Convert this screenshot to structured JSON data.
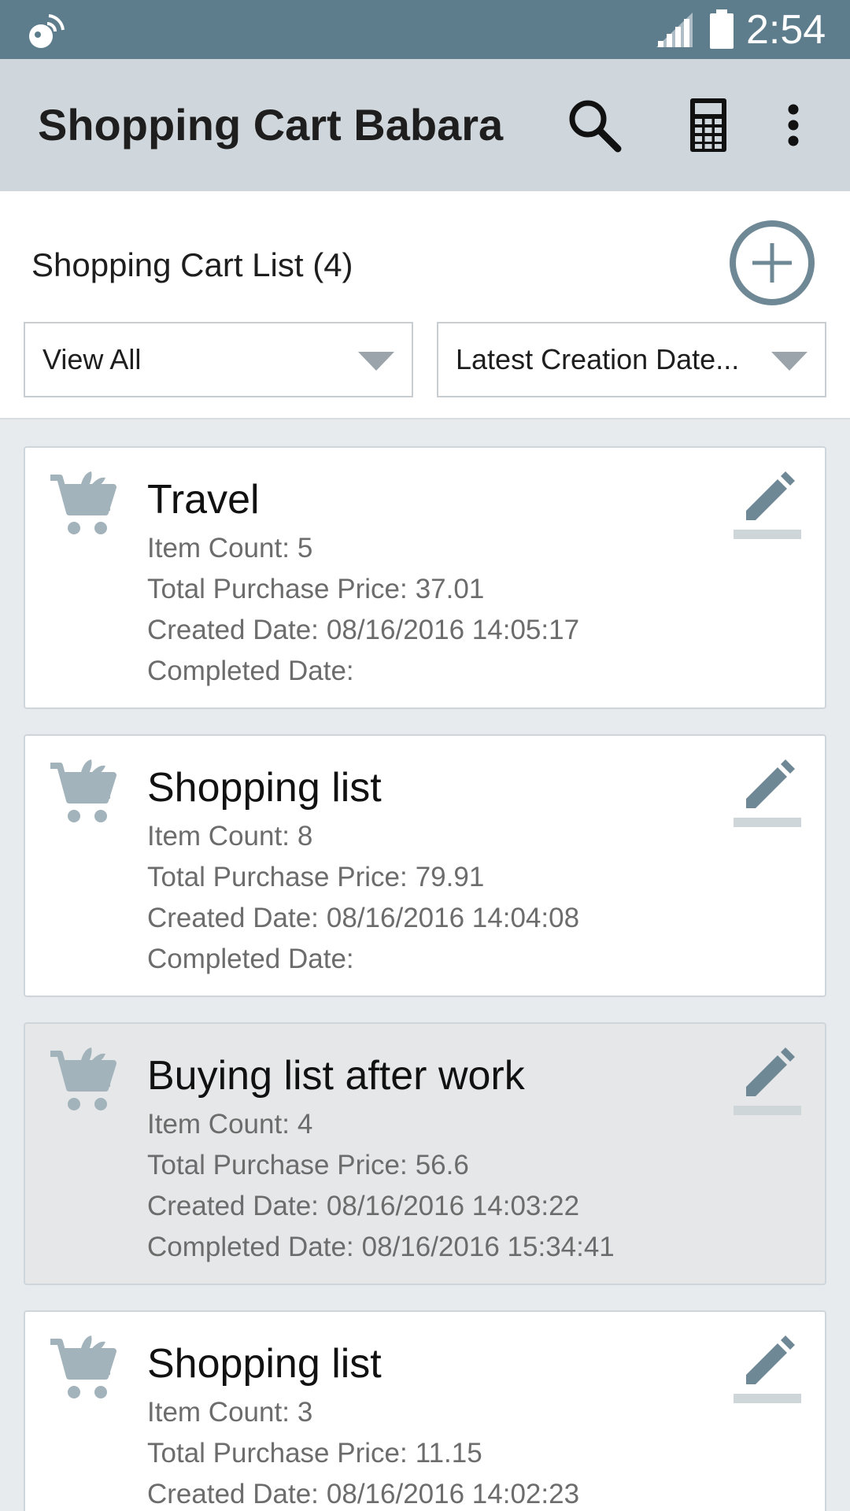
{
  "status_bar": {
    "time": "2:54",
    "icons": [
      "notification-icon",
      "signal-icon",
      "battery-icon"
    ]
  },
  "app_bar": {
    "title": "Shopping Cart Babara",
    "actions": [
      "search-icon",
      "calculator-icon",
      "more-vert-icon"
    ]
  },
  "list_header": {
    "title": "Shopping Cart List (4)",
    "add_icon": "add-circle-icon",
    "filter": {
      "selected": "View All"
    },
    "sort": {
      "selected": "Latest Creation Date..."
    }
  },
  "labels": {
    "item_count": "Item Count:",
    "total_price": "Total Purchase Price:",
    "created_date": "Created Date:",
    "completed_date": "Completed Date:"
  },
  "carts": [
    {
      "title": "Travel",
      "item_count": "5",
      "total_price": "37.01",
      "created": "08/16/2016 14:05:17",
      "completed": ""
    },
    {
      "title": "Shopping list",
      "item_count": "8",
      "total_price": "79.91",
      "created": "08/16/2016 14:04:08",
      "completed": ""
    },
    {
      "title": "Buying list after work",
      "item_count": "4",
      "total_price": "56.6",
      "created": "08/16/2016 14:03:22",
      "completed": "08/16/2016 15:34:41"
    },
    {
      "title": "Shopping list",
      "item_count": "3",
      "total_price": "11.15",
      "created": "08/16/2016 14:02:23",
      "completed": ""
    }
  ],
  "colors": {
    "status_bar": "#5e7d8c",
    "app_bar": "#d0d7dc",
    "background": "#e7ebee",
    "icon_tint": "#8aa0ab",
    "completed_card": "#e5e7e8"
  }
}
